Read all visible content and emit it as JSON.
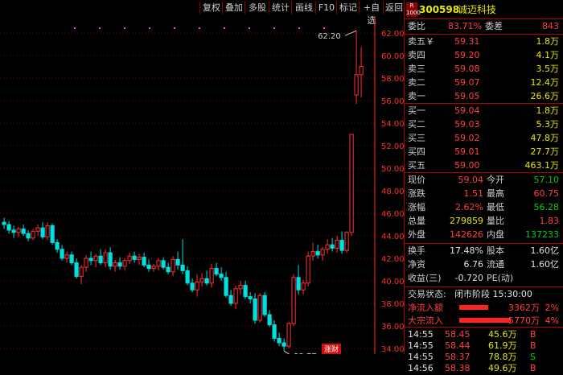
{
  "toolbar": [
    "复权",
    "叠加",
    "多股",
    "统计",
    "画线",
    "F10",
    "标记",
    "+自选",
    "返回"
  ],
  "badge": {
    "top": "R",
    "bottom": "1000"
  },
  "stock": {
    "code": "300598",
    "name": "诚迈科技"
  },
  "ratio": {
    "label1": "委比",
    "value1": "83.71%",
    "label2": "委差",
    "value2": "843"
  },
  "asks": [
    {
      "label": "卖五￥",
      "price": "59.31",
      "vol": "1.8万"
    },
    {
      "label": "卖四",
      "price": "59.20",
      "vol": "4.1万"
    },
    {
      "label": "卖三",
      "price": "59.08",
      "vol": "3.5万"
    },
    {
      "label": "卖二",
      "price": "59.07",
      "vol": "12.4万"
    },
    {
      "label": "卖一",
      "price": "59.05",
      "vol": "26.6万"
    }
  ],
  "bids": [
    {
      "label": "买一",
      "price": "59.04",
      "vol": "1.8万"
    },
    {
      "label": "买二",
      "price": "59.03",
      "vol": "5.3万"
    },
    {
      "label": "买三",
      "price": "59.02",
      "vol": "47.8万"
    },
    {
      "label": "买四",
      "price": "59.01",
      "vol": "27.7万"
    },
    {
      "label": "买五",
      "price": "59.00",
      "vol": "463.1万"
    }
  ],
  "quote": [
    {
      "l1": "现价",
      "v1": "59.04",
      "c1": "red",
      "l2": "今开",
      "v2": "57.10",
      "c2": "green"
    },
    {
      "l1": "涨跌",
      "v1": "1.51",
      "c1": "red",
      "l2": "最高",
      "v2": "60.75",
      "c2": "red"
    },
    {
      "l1": "涨幅",
      "v1": "2.62%",
      "c1": "red",
      "l2": "最低",
      "v2": "56.28",
      "c2": "green"
    },
    {
      "l1": "总量",
      "v1": "279859",
      "c1": "yel",
      "l2": "量比",
      "v2": "1.83",
      "c2": "red"
    },
    {
      "l1": "外盘",
      "v1": "142626",
      "c1": "red",
      "l2": "内盘",
      "v2": "137233",
      "c2": "green"
    }
  ],
  "fund": [
    {
      "l1": "换手",
      "v1": "17.48%",
      "l2": "股本",
      "v2": "1.60亿"
    },
    {
      "l1": "净资",
      "v1": "6.76",
      "l2": "流通",
      "v2": "1.60亿"
    },
    {
      "l1": "收益(三)",
      "v1": "-0.720",
      "l2": "PE(动)",
      "v2": ""
    }
  ],
  "trade_status": {
    "label": "交易状态:",
    "value": "闭市阶段 15:30:00"
  },
  "flows": [
    {
      "label": "净流入额",
      "amount": "3362万",
      "pct": "2%"
    },
    {
      "label": "大宗流入",
      "amount": "5770万",
      "pct": "4%"
    }
  ],
  "ticks": [
    {
      "time": "14:55",
      "price": "58.45",
      "vol": "45.6万",
      "side": "B"
    },
    {
      "time": "14:55",
      "price": "58.44",
      "vol": "61.9万",
      "side": "B"
    },
    {
      "time": "14:55",
      "price": "58.37",
      "vol": "78.8万",
      "side": "S"
    },
    {
      "time": "14:56",
      "price": "58.38",
      "vol": "49.6万",
      "side": "B"
    }
  ],
  "chart_labels": {
    "high_marker": "62.20",
    "low_marker": "33.77",
    "badge": "涨财"
  },
  "colors": {
    "up": "#ff3030",
    "down": "#00e0e0",
    "grid": "#8b0000",
    "axis": "#ff3030"
  },
  "chart_data": {
    "type": "candlestick",
    "ylim": [
      33.5,
      63.5
    ],
    "y_ticks": [
      34,
      36,
      38,
      40,
      42,
      44,
      46,
      48,
      50,
      52,
      54,
      56,
      58,
      60,
      62
    ],
    "candles": [
      [
        45.2,
        45.6,
        44.6,
        45.0
      ],
      [
        45.0,
        45.3,
        44.2,
        44.5
      ],
      [
        44.5,
        44.9,
        43.8,
        44.3
      ],
      [
        44.3,
        44.8,
        43.9,
        44.6
      ],
      [
        44.6,
        45.0,
        44.0,
        44.2
      ],
      [
        44.2,
        44.5,
        43.5,
        43.8
      ],
      [
        43.8,
        44.6,
        43.6,
        44.4
      ],
      [
        44.4,
        45.0,
        44.0,
        44.7
      ],
      [
        44.7,
        45.2,
        43.7,
        43.9
      ],
      [
        43.9,
        45.2,
        43.6,
        44.9
      ],
      [
        44.9,
        45.1,
        43.2,
        43.4
      ],
      [
        43.4,
        43.7,
        42.5,
        42.8
      ],
      [
        42.8,
        43.2,
        41.8,
        42.0
      ],
      [
        42.0,
        42.6,
        41.6,
        42.3
      ],
      [
        42.3,
        42.6,
        41.4,
        41.6
      ],
      [
        41.6,
        42.0,
        40.2,
        40.4
      ],
      [
        40.4,
        41.4,
        39.7,
        41.2
      ],
      [
        41.2,
        42.3,
        40.8,
        42.0
      ],
      [
        42.0,
        42.6,
        41.4,
        41.8
      ],
      [
        41.8,
        42.4,
        41.2,
        42.2
      ],
      [
        42.2,
        42.8,
        41.4,
        41.6
      ],
      [
        41.6,
        42.8,
        41.2,
        42.5
      ],
      [
        42.5,
        43.0,
        41.0,
        41.3
      ],
      [
        41.3,
        41.9,
        40.8,
        41.6
      ],
      [
        41.6,
        42.1,
        41.0,
        41.3
      ],
      [
        41.3,
        42.0,
        40.9,
        41.8
      ],
      [
        41.8,
        42.5,
        41.5,
        42.2
      ],
      [
        42.2,
        42.6,
        41.6,
        41.9
      ],
      [
        41.9,
        42.4,
        41.4,
        42.1
      ],
      [
        42.1,
        42.5,
        41.2,
        41.4
      ],
      [
        41.4,
        41.9,
        40.8,
        41.1
      ],
      [
        41.1,
        41.5,
        40.8,
        41.3
      ],
      [
        41.3,
        42.0,
        40.9,
        41.8
      ],
      [
        41.8,
        42.1,
        41.0,
        41.2
      ],
      [
        41.2,
        41.6,
        40.6,
        40.8
      ],
      [
        40.8,
        42.2,
        40.4,
        41.9
      ],
      [
        41.9,
        42.6,
        41.0,
        41.4
      ],
      [
        41.4,
        43.7,
        40.6,
        40.9
      ],
      [
        40.9,
        41.3,
        39.6,
        39.8
      ],
      [
        39.8,
        40.2,
        39.0,
        39.2
      ],
      [
        39.2,
        40.6,
        38.6,
        39.9
      ],
      [
        39.9,
        40.7,
        39.5,
        40.2
      ],
      [
        40.2,
        40.9,
        39.6,
        39.8
      ],
      [
        39.8,
        41.5,
        39.4,
        41.1
      ],
      [
        41.1,
        41.6,
        40.4,
        40.6
      ],
      [
        40.6,
        41.2,
        40.0,
        40.3
      ],
      [
        40.3,
        40.8,
        38.5,
        38.7
      ],
      [
        38.7,
        39.2,
        37.8,
        38.0
      ],
      [
        38.0,
        39.6,
        37.5,
        39.3
      ],
      [
        39.3,
        40.0,
        38.8,
        39.6
      ],
      [
        39.6,
        40.0,
        38.4,
        38.6
      ],
      [
        38.6,
        39.0,
        38.0,
        38.4
      ],
      [
        38.4,
        38.9,
        36.2,
        36.5
      ],
      [
        36.5,
        38.9,
        36.3,
        38.7
      ],
      [
        38.7,
        39.0,
        36.8,
        37.0
      ],
      [
        37.0,
        37.4,
        35.9,
        36.1
      ],
      [
        36.1,
        36.5,
        34.6,
        34.9
      ],
      [
        34.9,
        35.4,
        34.2,
        34.5
      ],
      [
        34.5,
        34.9,
        33.77,
        34.2
      ],
      [
        34.2,
        36.4,
        34.0,
        36.2
      ],
      [
        36.2,
        40.6,
        36.0,
        40.3
      ],
      [
        40.3,
        41.4,
        38.8,
        39.2
      ],
      [
        39.2,
        40.1,
        38.8,
        39.8
      ],
      [
        39.8,
        42.6,
        39.5,
        42.2
      ],
      [
        42.2,
        43.4,
        41.8,
        42.6
      ],
      [
        42.6,
        43.2,
        42.0,
        42.3
      ],
      [
        42.3,
        43.0,
        41.8,
        42.8
      ],
      [
        42.8,
        43.7,
        42.4,
        43.2
      ],
      [
        43.2,
        43.8,
        42.6,
        42.9
      ],
      [
        42.9,
        44.0,
        42.5,
        43.6
      ],
      [
        43.6,
        44.4,
        42.4,
        42.7
      ],
      [
        42.7,
        44.4,
        42.5,
        44.3
      ],
      [
        44.3,
        53.0,
        44.0,
        53.0
      ],
      [
        56.5,
        62.2,
        55.7,
        58.3
      ],
      [
        58.3,
        60.75,
        56.28,
        59.04
      ]
    ]
  }
}
